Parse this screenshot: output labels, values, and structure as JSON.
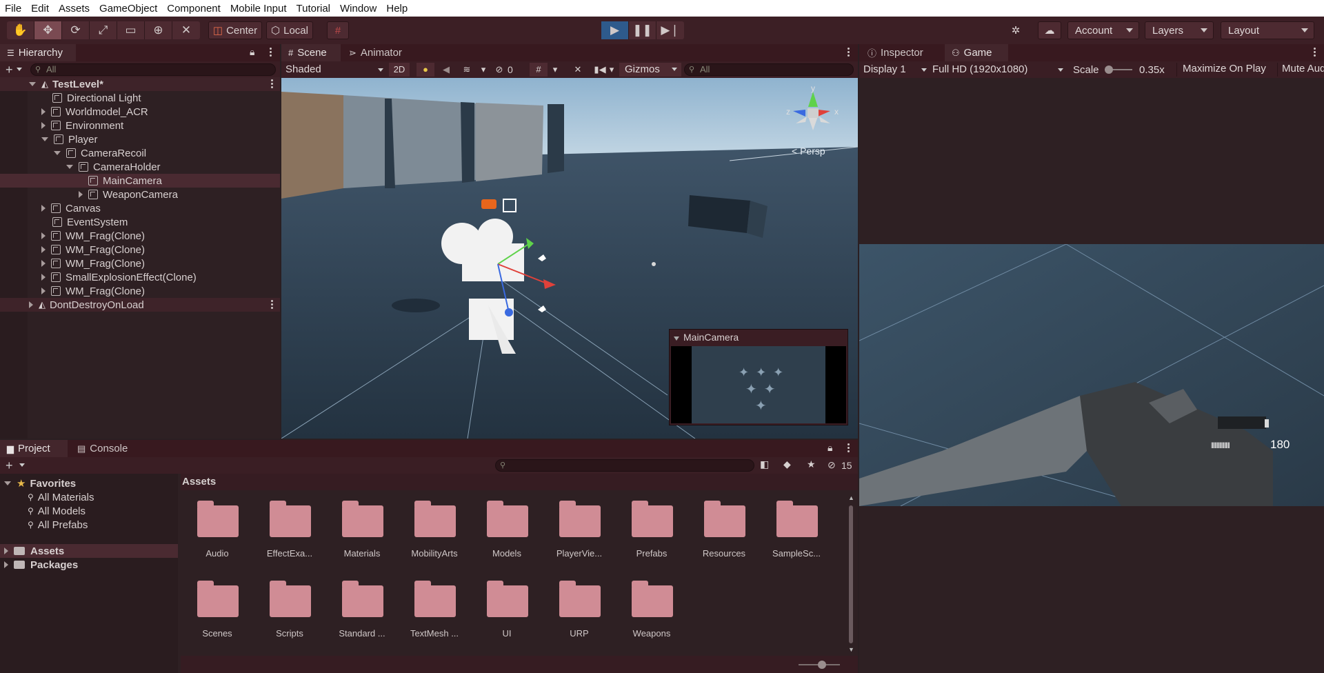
{
  "menu": [
    "File",
    "Edit",
    "Assets",
    "GameObject",
    "Component",
    "Mobile Input",
    "Tutorial",
    "Window",
    "Help"
  ],
  "toolbar": {
    "pivot": "Center",
    "space": "Local",
    "account": "Account",
    "layers": "Layers",
    "layout": "Layout"
  },
  "hierarchy": {
    "tab": "Hierarchy",
    "search_placeholder": "All",
    "scene": "TestLevel*",
    "items": [
      {
        "label": "Directional Light"
      },
      {
        "label": "Worldmodel_ACR"
      },
      {
        "label": "Environment"
      },
      {
        "label": "Player"
      },
      {
        "label": "CameraRecoil"
      },
      {
        "label": "CameraHolder"
      },
      {
        "label": "MainCamera"
      },
      {
        "label": "WeaponCamera"
      },
      {
        "label": "Canvas"
      },
      {
        "label": "EventSystem"
      },
      {
        "label": "WM_Frag(Clone)"
      },
      {
        "label": "WM_Frag(Clone)"
      },
      {
        "label": "WM_Frag(Clone)"
      },
      {
        "label": "SmallExplosionEffect(Clone)"
      },
      {
        "label": "WM_Frag(Clone)"
      }
    ],
    "dont_destroy": "DontDestroyOnLoad"
  },
  "scene_view": {
    "tabs": [
      "Scene",
      "Animator"
    ],
    "shading": "Shaded",
    "mode_2d": "2D",
    "hidden_count": "0",
    "gizmos": "Gizmos",
    "search_placeholder": "All",
    "persp": "Persp",
    "axis_y": "y",
    "axis_x": "x",
    "axis_z": "z",
    "camera_preview_title": "MainCamera"
  },
  "game_view": {
    "tabs": [
      "Inspector",
      "Game"
    ],
    "display": "Display 1",
    "resolution": "Full HD (1920x1080)",
    "scale_label": "Scale",
    "scale_value": "0.35x",
    "maximize": "Maximize On Play",
    "mute": "Mute Aud",
    "ammo": "180"
  },
  "project": {
    "tabs": [
      "Project",
      "Console"
    ],
    "hidden_count": "15",
    "favorites": "Favorites",
    "favorite_items": [
      "All Materials",
      "All Models",
      "All Prefabs"
    ],
    "roots": [
      "Assets",
      "Packages"
    ],
    "breadcrumb": "Assets",
    "folders": [
      "Audio",
      "EffectExa...",
      "Materials",
      "MobilityArts",
      "Models",
      "PlayerVie...",
      "Prefabs",
      "Resources",
      "SampleSc...",
      "Scenes",
      "Scripts",
      "Standard ...",
      "TextMesh ...",
      "UI",
      "URP",
      "Weapons"
    ]
  },
  "colors": {
    "accent_play": "#2e5a8c",
    "folder": "#d08c95",
    "panel": "#2e2023",
    "toolbar": "#3c1f25"
  }
}
